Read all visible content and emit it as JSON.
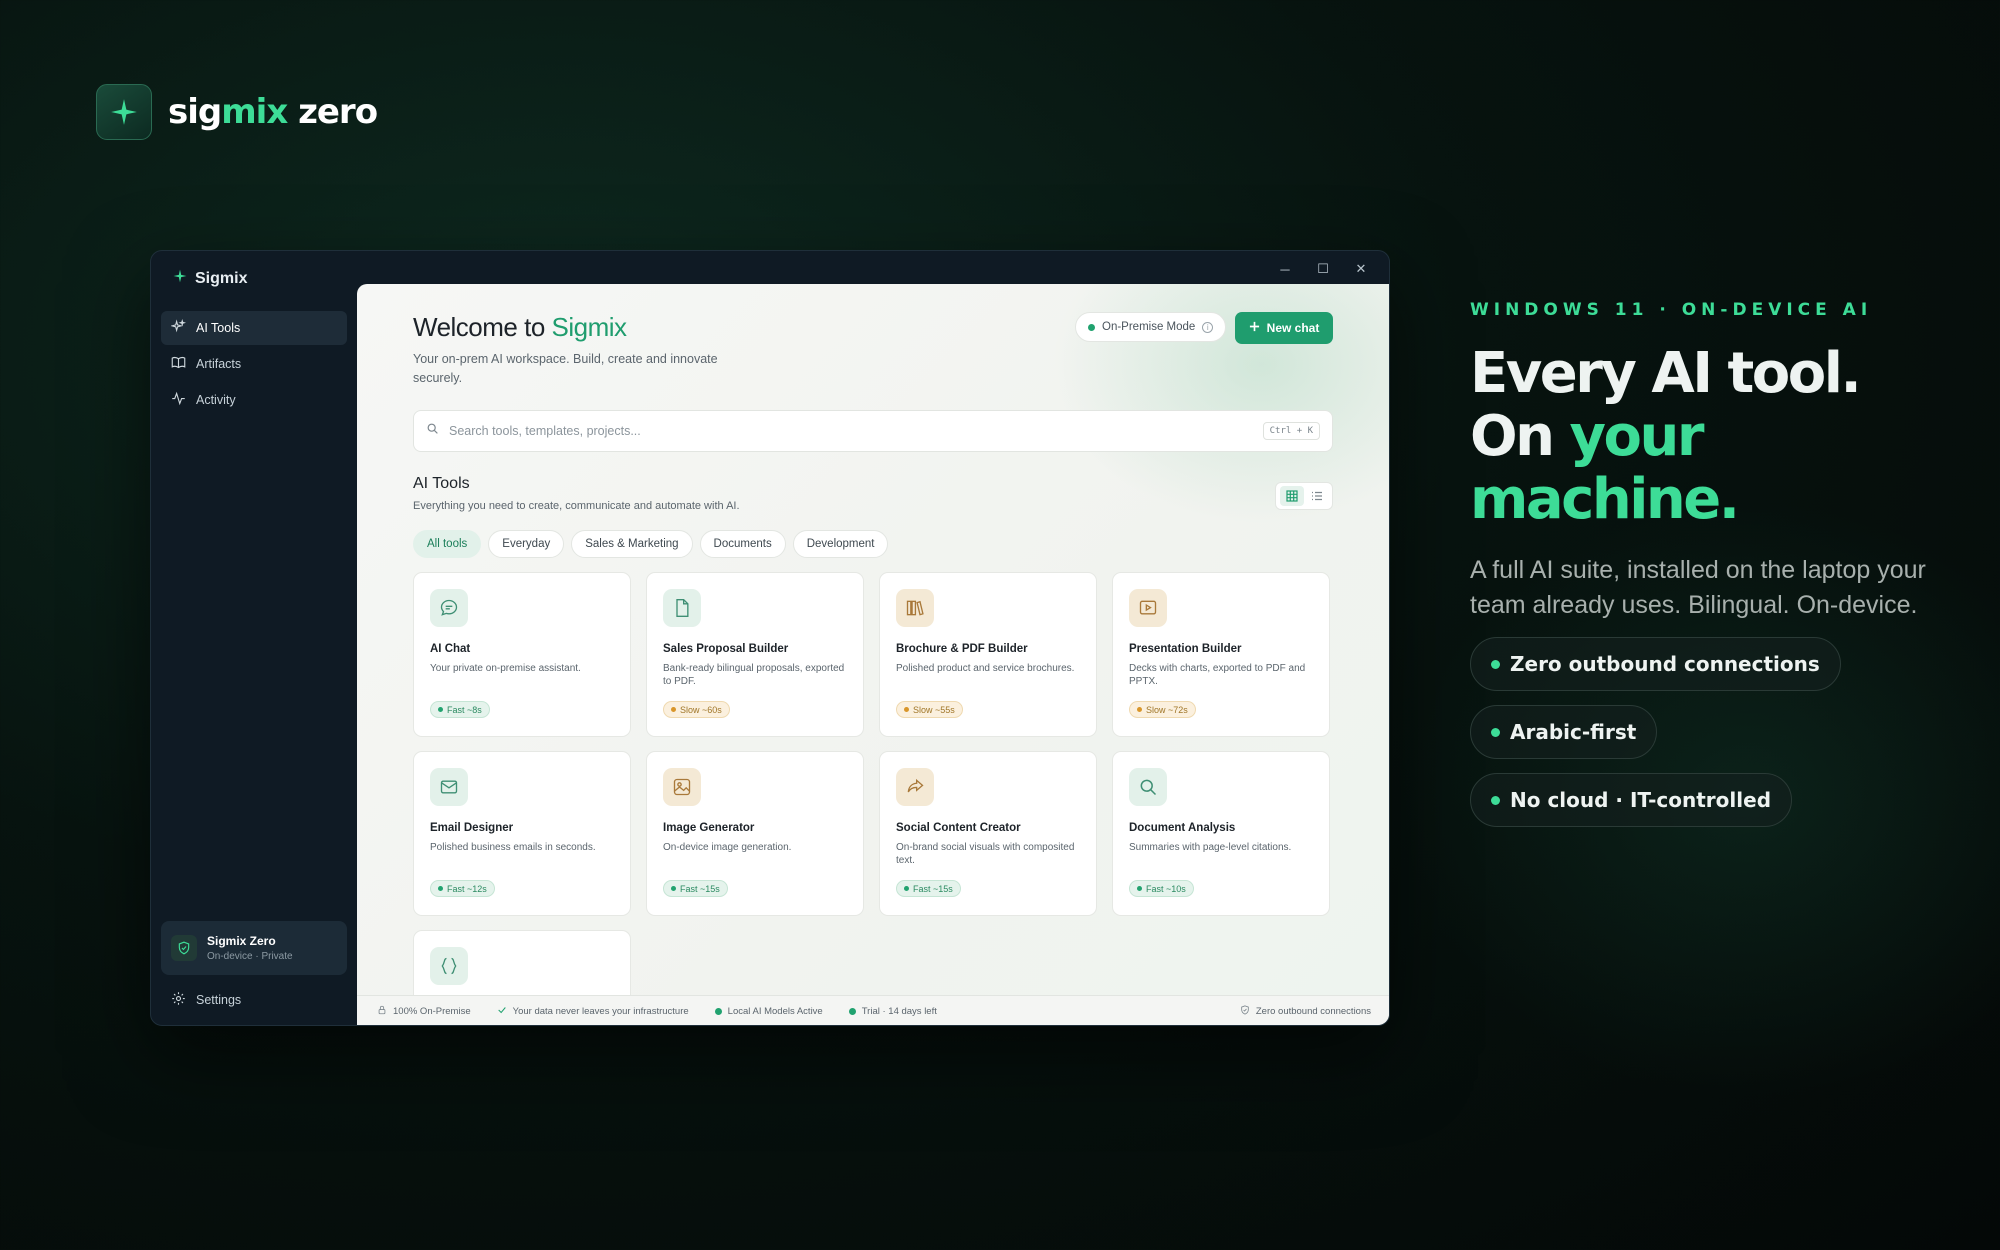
{
  "brand": {
    "name_a": "sig",
    "name_b": "mix",
    "name_c": " zero"
  },
  "window": {
    "app_title": "Sigmix",
    "controls": {
      "minimize": "─",
      "maximize": "☐",
      "close": "✕"
    }
  },
  "sidebar": {
    "items": [
      {
        "label": "AI Tools",
        "icon": "sparkle-icon",
        "active": true
      },
      {
        "label": "Artifacts",
        "icon": "book-icon",
        "active": false
      },
      {
        "label": "Activity",
        "icon": "activity-icon",
        "active": false
      }
    ],
    "account": {
      "name": "Sigmix Zero",
      "subtitle": "On-device · Private"
    },
    "settings_label": "Settings"
  },
  "main": {
    "welcome_prefix": "Welcome to ",
    "welcome_brand": "Sigmix",
    "subtitle": "Your on-prem AI workspace. Build, create and innovate securely.",
    "mode_label": "On-Premise Mode",
    "new_chat_label": "New chat",
    "search": {
      "placeholder": "Search tools, templates, projects...",
      "shortcut": "Ctrl + K"
    },
    "section_title": "AI Tools",
    "section_subtitle": "Everything you need to create, communicate and automate with AI.",
    "filters": [
      "All tools",
      "Everyday",
      "Sales & Marketing",
      "Documents",
      "Development"
    ],
    "active_filter": "All tools",
    "tools": [
      {
        "title": "AI Chat",
        "desc": "Your private on-premise assistant.",
        "speed": "Fast ~8s",
        "speed_type": "fast",
        "icon": "chat-bubble-icon",
        "tone": "green"
      },
      {
        "title": "Sales Proposal Builder",
        "desc": "Bank-ready bilingual proposals, exported to PDF.",
        "speed": "Slow ~60s",
        "speed_type": "slow",
        "icon": "document-icon",
        "tone": "green"
      },
      {
        "title": "Brochure & PDF Builder",
        "desc": "Polished product and service brochures.",
        "speed": "Slow ~55s",
        "speed_type": "slow",
        "icon": "library-icon",
        "tone": "tan"
      },
      {
        "title": "Presentation Builder",
        "desc": "Decks with charts, exported to PDF and PPTX.",
        "speed": "Slow ~72s",
        "speed_type": "slow",
        "icon": "presentation-icon",
        "tone": "tan"
      },
      {
        "title": "Email Designer",
        "desc": "Polished business emails in seconds.",
        "speed": "Fast ~12s",
        "speed_type": "fast",
        "icon": "mail-icon",
        "tone": "green"
      },
      {
        "title": "Image Generator",
        "desc": "On-device image generation.",
        "speed": "Fast ~15s",
        "speed_type": "fast",
        "icon": "image-icon",
        "tone": "tan"
      },
      {
        "title": "Social Content Creator",
        "desc": "On-brand social visuals with composited text.",
        "speed": "Fast ~15s",
        "speed_type": "fast",
        "icon": "share-icon",
        "tone": "tan"
      },
      {
        "title": "Document Analysis",
        "desc": "Summaries with page-level citations.",
        "speed": "Fast ~10s",
        "speed_type": "fast",
        "icon": "search-icon",
        "tone": "green"
      }
    ],
    "partial_tool_icon": "code-braces-icon",
    "status_bar": {
      "on_prem": "100% On-Premise",
      "data": "Your data never leaves your infrastructure",
      "models": "Local AI Models Active",
      "trial": "Trial · 14 days left",
      "outbound": "Zero outbound connections"
    }
  },
  "hero": {
    "kicker": "WINDOWS 11 · ON-DEVICE AI",
    "line1": "Every AI tool.",
    "line2a": "On ",
    "line2b": "your",
    "line3": "machine.",
    "lead": "A full AI suite, installed on the laptop your team already uses. Bilingual. On-device.",
    "pills": [
      "Zero outbound connections",
      "Arabic-first",
      "No cloud · IT-controlled"
    ]
  },
  "colors": {
    "accent": "#3ddc97",
    "primary": "#1f9d6e",
    "background": "#07130f"
  }
}
